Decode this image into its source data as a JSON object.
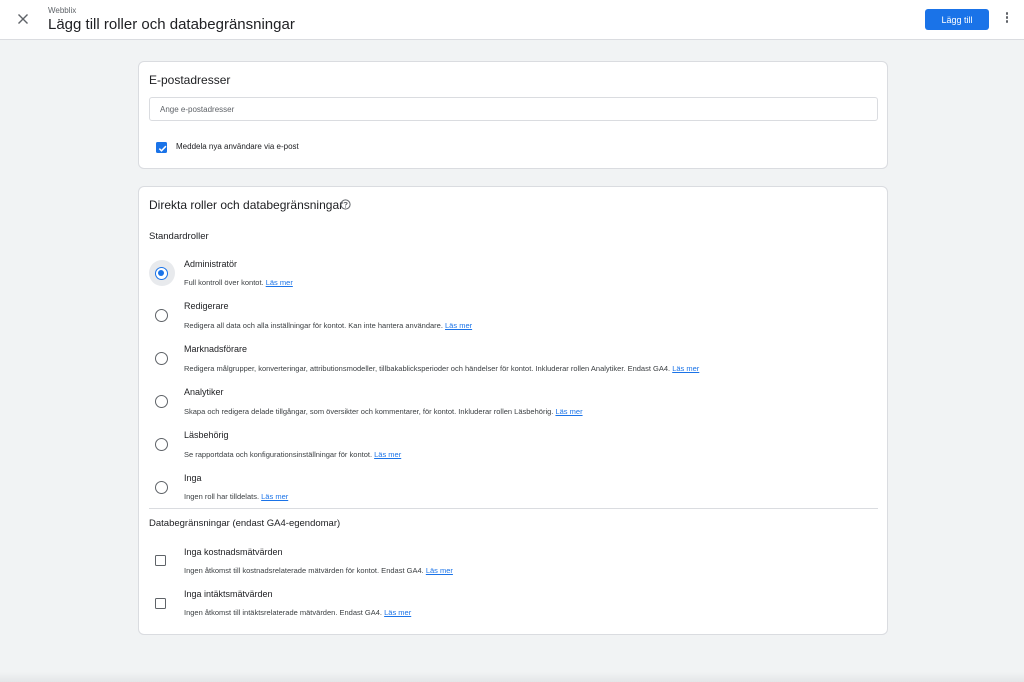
{
  "header": {
    "app_name": "Webblix",
    "title": "Lägg till roller och databegränsningar",
    "add_button": "Lägg till"
  },
  "email_card": {
    "title": "E-postadresser",
    "input_placeholder": "Ange e-postadresser",
    "input_value": "",
    "notify_label": "Meddela nya användare via e-post",
    "notify_checked": true
  },
  "roles_card": {
    "title": "Direkta roller och databegränsningar",
    "standard_roles_title": "Standardroller",
    "roles": [
      {
        "label": "Administratör",
        "desc": "Full kontroll över kontot.",
        "link": "Läs mer",
        "selected": true
      },
      {
        "label": "Redigerare",
        "desc": "Redigera all data och alla inställningar för kontot. Kan inte hantera användare.",
        "link": "Läs mer",
        "selected": false
      },
      {
        "label": "Marknadsförare",
        "desc": "Redigera målgrupper, konverteringar, attributionsmodeller, tillbakablicksperioder och händelser för kontot. Inkluderar rollen Analytiker. Endast GA4.",
        "link": "Läs mer",
        "selected": false
      },
      {
        "label": "Analytiker",
        "desc": "Skapa och redigera delade tillgångar, som översikter och kommentarer, för kontot. Inkluderar rollen Läsbehörig.",
        "link": "Läs mer",
        "selected": false
      },
      {
        "label": "Läsbehörig",
        "desc": "Se rapportdata och konfigurationsinställningar för kontot.",
        "link": "Läs mer",
        "selected": false
      },
      {
        "label": "Inga",
        "desc": "Ingen roll har tilldelats.",
        "link": "Läs mer",
        "selected": false
      }
    ],
    "restrictions_title": "Databegränsningar (endast GA4-egendomar)",
    "restrictions": [
      {
        "label": "Inga kostnadsmätvärden",
        "desc": "Ingen åtkomst till kostnadsrelaterade mätvärden för kontot. Endast GA4.",
        "link": "Läs mer",
        "checked": false
      },
      {
        "label": "Inga intäktsmätvärden",
        "desc": "Ingen åtkomst till intäktsrelaterade mätvärden. Endast GA4.",
        "link": "Läs mer",
        "checked": false
      }
    ]
  },
  "icons": {
    "close": "close-icon",
    "more": "more-vert-icon",
    "help": "help-circle-icon",
    "check": "check-icon"
  },
  "colors": {
    "accent": "#1a73e8",
    "background": "#f1f3f4"
  }
}
